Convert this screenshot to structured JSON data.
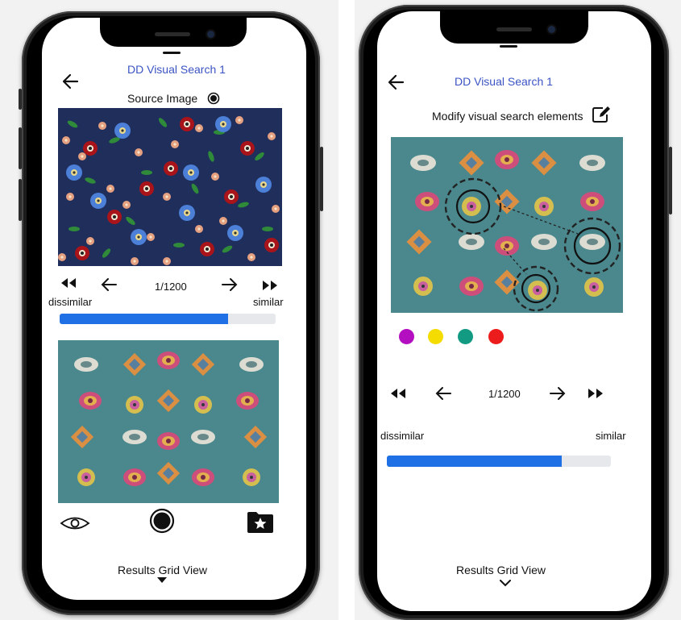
{
  "left_screen": {
    "title": "DD Visual Search 1",
    "source_label": "Source Image",
    "counter": "1/1200",
    "dissimilar_label": "dissimilar",
    "similar_label": "similar",
    "progress": 0.78,
    "results_label": "Results Grid View",
    "icons": [
      "back-arrow-icon",
      "radio-icon",
      "rewind-icon",
      "arrow-left-icon",
      "arrow-right-icon",
      "fast-forward-icon",
      "eye-icon",
      "shutter-icon",
      "folder-star-icon",
      "caret-down-icon"
    ]
  },
  "right_screen": {
    "title": "DD Visual Search 1",
    "modify_label": "Modify visual search elements",
    "counter": "1/1200",
    "dissimilar_label": "dissimilar",
    "similar_label": "similar",
    "progress": 0.78,
    "results_label": "Results Grid View",
    "swatches": [
      "#b30fc0",
      "#f5dc00",
      "#139a82",
      "#ec1c1c"
    ],
    "icons": [
      "back-arrow-icon",
      "edit-icon",
      "rewind-icon",
      "arrow-left-icon",
      "arrow-right-icon",
      "fast-forward-icon",
      "chevron-down-icon"
    ]
  },
  "colors": {
    "accent": "#1f6fe5",
    "title": "#3b54c4"
  }
}
